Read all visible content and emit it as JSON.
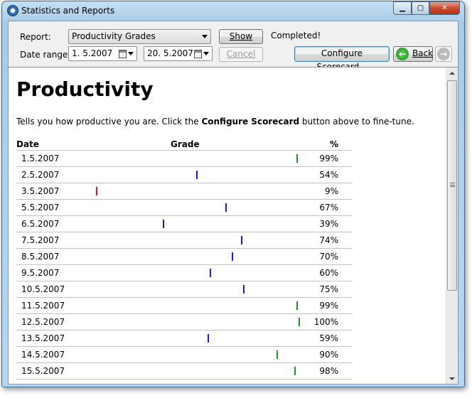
{
  "window": {
    "title": "Statistics and Reports"
  },
  "toolbar": {
    "report_label": "Report:",
    "report_value": "Productivity Grades",
    "show_label": "Show",
    "status": "Completed!",
    "date_range_label": "Date range:",
    "date_from": "1.  5.2007",
    "date_to": "20.  5.2007",
    "cancel_label": "Cancel",
    "configure_label": "Configure Scorecard...",
    "back_label": "Back"
  },
  "report": {
    "title": "Productivity",
    "desc_before": "Tells you how productive you are. Click the ",
    "desc_bold": "Configure Scorecard",
    "desc_after": " button above to fine-tune.",
    "columns": [
      "Date",
      "Grade",
      "%"
    ],
    "colors": {
      "high": "#1a9a1a",
      "mid": "#1a1ae0",
      "low": "#e01a1a"
    },
    "rows": [
      {
        "date": "1.5.2007",
        "pct": 99,
        "label": "99%"
      },
      {
        "date": "2.5.2007",
        "pct": 54,
        "label": "54%"
      },
      {
        "date": "3.5.2007",
        "pct": 9,
        "label": "9%"
      },
      {
        "date": "5.5.2007",
        "pct": 67,
        "label": "67%"
      },
      {
        "date": "6.5.2007",
        "pct": 39,
        "label": "39%"
      },
      {
        "date": "7.5.2007",
        "pct": 74,
        "label": "74%"
      },
      {
        "date": "8.5.2007",
        "pct": 70,
        "label": "70%"
      },
      {
        "date": "9.5.2007",
        "pct": 60,
        "label": "60%"
      },
      {
        "date": "10.5.2007",
        "pct": 75,
        "label": "75%"
      },
      {
        "date": "11.5.2007",
        "pct": 99,
        "label": "99%"
      },
      {
        "date": "12.5.2007",
        "pct": 100,
        "label": "100%"
      },
      {
        "date": "13.5.2007",
        "pct": 59,
        "label": "59%"
      },
      {
        "date": "14.5.2007",
        "pct": 90,
        "label": "90%"
      },
      {
        "date": "15.5.2007",
        "pct": 98,
        "label": "98%"
      }
    ]
  }
}
